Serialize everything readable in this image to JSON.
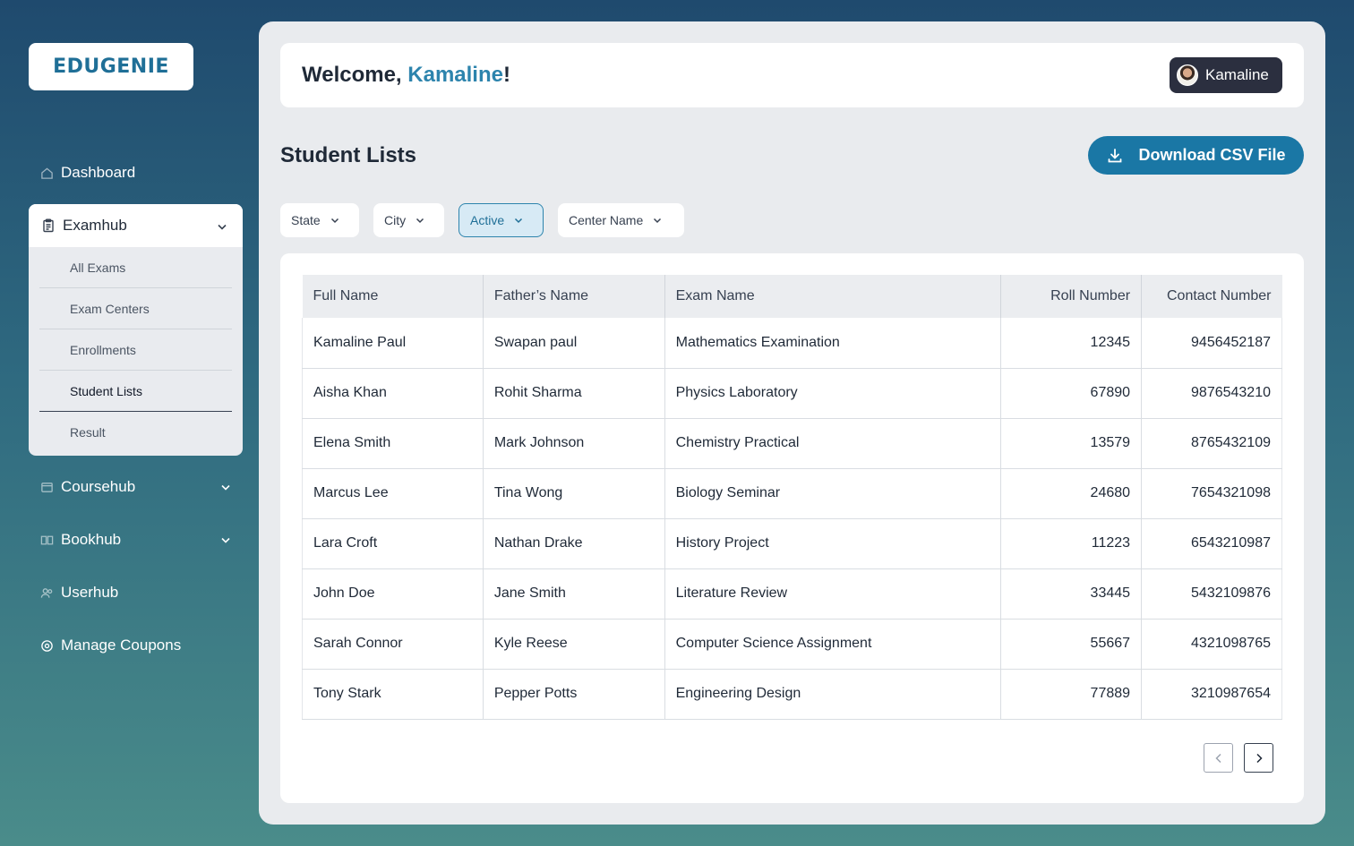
{
  "brand": {
    "logo_text": "EDUGENIE"
  },
  "sidebar": {
    "dashboard": "Dashboard",
    "examhub": {
      "label": "Examhub",
      "items": [
        "All Exams",
        "Exam Centers",
        "Enrollments",
        "Student Lists",
        "Result"
      ],
      "active": "Student Lists"
    },
    "coursehub": "Coursehub",
    "bookhub": "Bookhub",
    "userhub": "Userhub",
    "coupons": "Manage Coupons"
  },
  "header": {
    "welcome_prefix": "Welcome, ",
    "user_name": "Kamaline",
    "welcome_suffix": "!",
    "chip_name": "Kamaline"
  },
  "page": {
    "title": "Student Lists",
    "download_label": "Download CSV File"
  },
  "filters": [
    {
      "label": "State",
      "active": false
    },
    {
      "label": "City",
      "active": false
    },
    {
      "label": "Active",
      "active": true
    },
    {
      "label": "Center Name",
      "active": false
    }
  ],
  "table": {
    "columns": [
      "Full Name",
      "Father’s Name",
      "Exam Name",
      "Roll Number",
      "Contact Number"
    ],
    "rows": [
      [
        "Kamaline Paul",
        "Swapan paul",
        "Mathematics Examination",
        "12345",
        "9456452187"
      ],
      [
        "Aisha Khan",
        "Rohit Sharma",
        "Physics Laboratory",
        "67890",
        "9876543210"
      ],
      [
        "Elena Smith",
        "Mark Johnson",
        "Chemistry Practical",
        "13579",
        "8765432109"
      ],
      [
        "Marcus Lee",
        "Tina Wong",
        "Biology Seminar",
        "24680",
        "7654321098"
      ],
      [
        "Lara Croft",
        "Nathan Drake",
        "History Project",
        "11223",
        "6543210987"
      ],
      [
        "John Doe",
        "Jane Smith",
        "Literature Review",
        "33445",
        "5432109876"
      ],
      [
        "Sarah Connor",
        "Kyle Reese",
        "Computer Science Assignment",
        "55667",
        "4321098765"
      ],
      [
        "Tony Stark",
        "Pepper Potts",
        "Engineering Design",
        "77889",
        "3210987654"
      ]
    ]
  },
  "colors": {
    "accent": "#1a77a5",
    "name_highlight": "#2d84ad",
    "chip_bg": "#2b2f3f"
  }
}
